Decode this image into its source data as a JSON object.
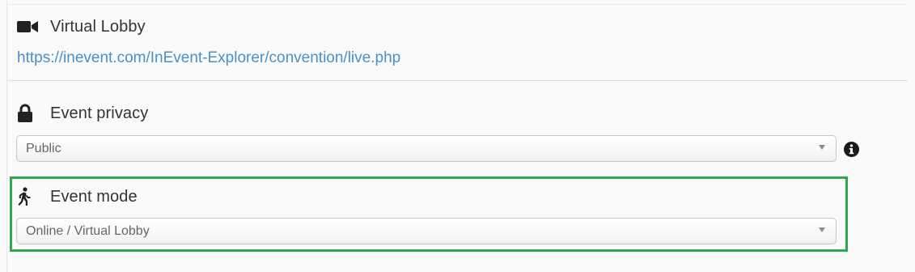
{
  "virtual_lobby": {
    "title": "Virtual Lobby",
    "icon": "video-camera-icon",
    "link_text": "https://inevent.com/InEvent-Explorer/convention/live.php"
  },
  "event_privacy": {
    "title": "Event privacy",
    "icon": "lock-icon",
    "selected_value": "Public",
    "info_icon": "info-icon"
  },
  "event_mode": {
    "title": "Event mode",
    "icon": "walking-person-icon",
    "selected_value": "Online / Virtual Lobby"
  },
  "colors": {
    "link": "#4a90c8",
    "highlight_border": "#2da84a",
    "background": "#fafafa",
    "text": "#333333"
  }
}
